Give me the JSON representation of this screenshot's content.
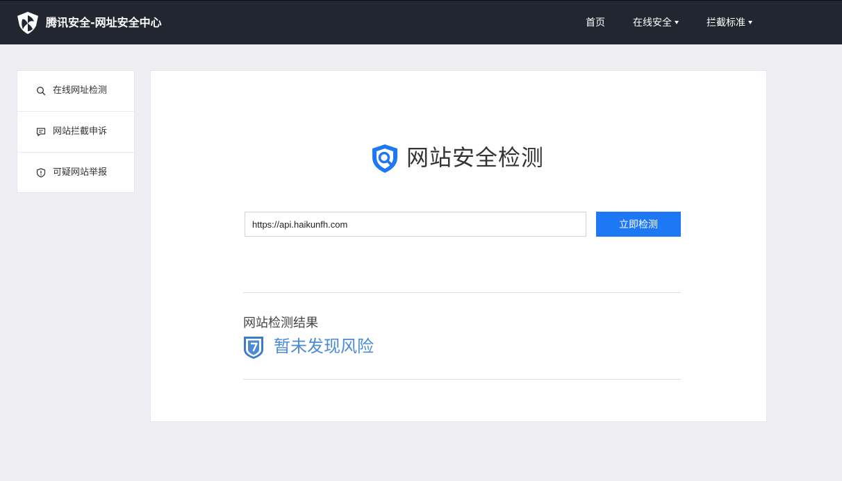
{
  "header": {
    "brand": "腾讯安全-网址安全中心",
    "logo_icon": "tencent-security-shield-logo",
    "nav": [
      {
        "label": "首页",
        "dropdown": false
      },
      {
        "label": "在线安全",
        "dropdown": true
      },
      {
        "label": "拦截标准",
        "dropdown": true
      }
    ]
  },
  "sidebar": {
    "items": [
      {
        "label": "在线网址检测",
        "icon": "search-icon"
      },
      {
        "label": "网站拦截申诉",
        "icon": "message-icon"
      },
      {
        "label": "可疑网站举报",
        "icon": "shield-alert-icon"
      }
    ]
  },
  "main": {
    "title": "网站安全检测",
    "title_icon": "shield-search-icon",
    "url_value": "https://api.haikunfh.com",
    "check_button": "立即检测",
    "result_label": "网站检测结果",
    "result_status": "暂未发现风险",
    "result_icon": "shield-safe-icon"
  },
  "colors": {
    "header_bg": "#222631",
    "accent": "#1e78f5",
    "safe_text": "#4a8ad6",
    "page_bg": "#efeff3"
  }
}
